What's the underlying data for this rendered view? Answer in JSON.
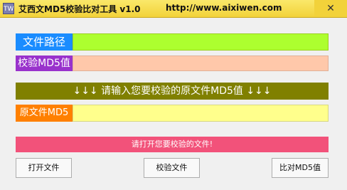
{
  "window": {
    "title": "艾西文MD5校验比对工具 v1.0",
    "url": "http://www.aixiwen.com",
    "icon": "TW",
    "close_glyph": "✕"
  },
  "file_path": {
    "label": "文件路径",
    "value": "",
    "label_color": "#1a8cff",
    "field_color": "#adff2f"
  },
  "md5": {
    "label": "校验MD5值",
    "value": "",
    "label_color": "#9932cc",
    "field_color": "#ffc8aa"
  },
  "banner": {
    "text": "↓↓↓ 请输入您要校验的原文件MD5值 ↓↓↓",
    "color": "#808000"
  },
  "original_md5": {
    "label": "原文件MD5",
    "value": "",
    "label_color": "#ff8000",
    "field_color": "#ffff8c"
  },
  "status": {
    "text": "请打开您要校验的文件!",
    "color": "#f2527a"
  },
  "buttons": {
    "open": "打开文件",
    "verify": "校验文件",
    "compare": "比对MD5值"
  }
}
